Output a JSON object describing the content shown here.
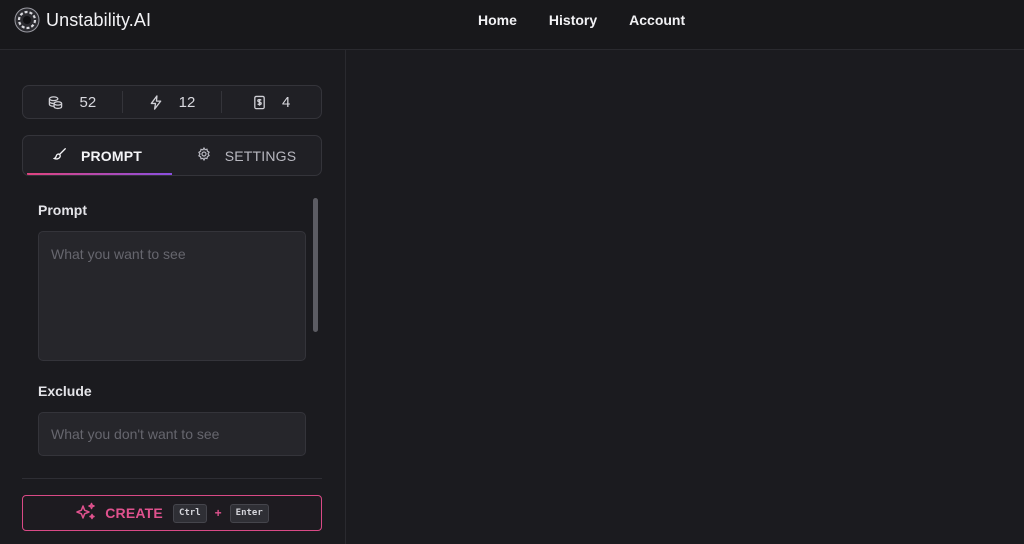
{
  "header": {
    "brand_name": "Unstability.AI",
    "nav": [
      {
        "label": "Home"
      },
      {
        "label": "History"
      },
      {
        "label": "Account"
      }
    ]
  },
  "stats": [
    {
      "icon": "coins-icon",
      "value": "52"
    },
    {
      "icon": "lightning-icon",
      "value": "12"
    },
    {
      "icon": "ticket-icon",
      "value": "4"
    }
  ],
  "tabs": [
    {
      "label": "PROMPT",
      "icon": "brush-icon",
      "active": true
    },
    {
      "label": "SETTINGS",
      "icon": "gear-icon",
      "active": false
    }
  ],
  "prompt": {
    "label": "Prompt",
    "placeholder": "What you want to see",
    "value": ""
  },
  "exclude": {
    "label": "Exclude",
    "placeholder": "What you don't want to see",
    "value": ""
  },
  "create": {
    "label": "CREATE",
    "icon": "sparkles-icon",
    "key1": "Ctrl",
    "plus": "+",
    "key2": "Enter"
  },
  "colors": {
    "accent_pink": "#e0528e",
    "accent_purple": "#8a4fe0",
    "background": "#1b1b1f"
  }
}
